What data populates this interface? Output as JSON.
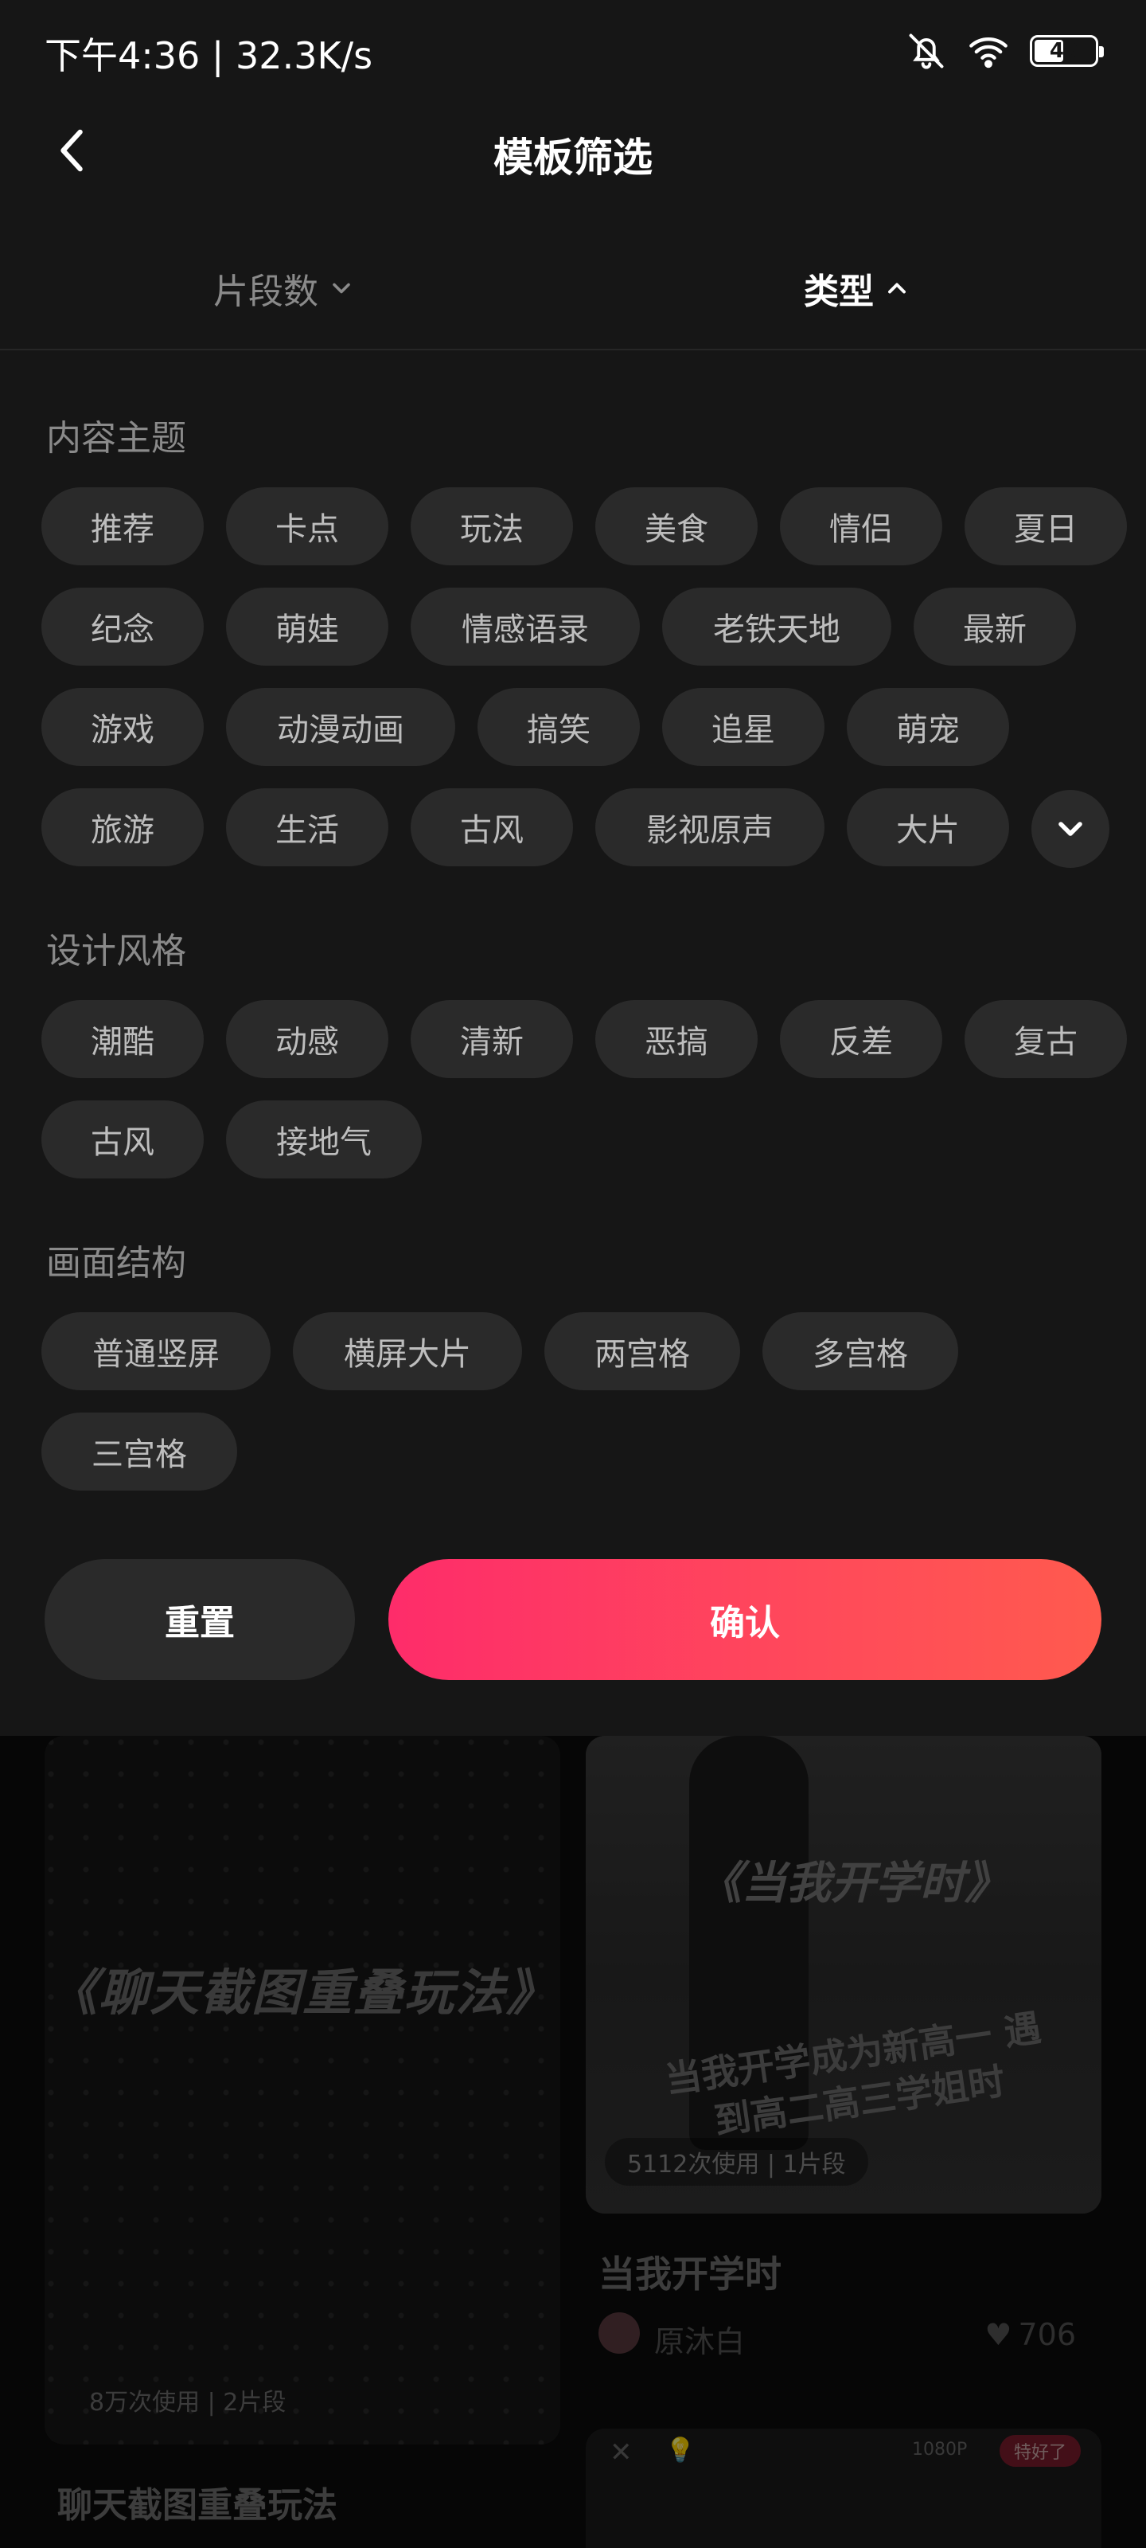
{
  "status_bar": {
    "time": "下午4:36 | 32.3K/s",
    "battery": "49",
    "battery_level": 0.49,
    "icons": [
      "mute-bell-icon",
      "wifi-icon",
      "battery-icon"
    ]
  },
  "nav": {
    "title": "模板筛选",
    "back_icon": "chevron-left-icon"
  },
  "tabs": [
    {
      "label": "片段数",
      "state": "collapsed"
    },
    {
      "label": "类型",
      "state": "expanded"
    }
  ],
  "sections": {
    "content_theme": {
      "title": "内容主题",
      "chips": [
        "推荐",
        "卡点",
        "玩法",
        "美食",
        "情侣",
        "夏日",
        "纪念",
        "萌娃",
        "情感语录",
        "老铁天地",
        "最新",
        "游戏",
        "动漫动画",
        "搞笑",
        "追星",
        "萌宠",
        "旅游",
        "生活",
        "古风",
        "影视原声",
        "大片"
      ]
    },
    "design_style": {
      "title": "设计风格",
      "chips": [
        "潮酷",
        "动感",
        "清新",
        "恶搞",
        "反差",
        "复古",
        "古风",
        "接地气"
      ]
    },
    "layout": {
      "title": "画面结构",
      "chips": [
        "普通竖屏",
        "横屏大片",
        "两宫格",
        "多宫格",
        "三宫格"
      ]
    }
  },
  "actions": {
    "reset": "重置",
    "confirm": "确认"
  },
  "background": {
    "card_left": {
      "tagline": "《聊天截图重叠玩法》",
      "usage": "8万次使用 | 2片段",
      "title": "聊天截图重叠玩法"
    },
    "card_right": {
      "quote": "《当我开学时》",
      "subtitle": "当我开学成为新高一 遇到高二高三学姐时",
      "usage": "5112次使用 | 1片段",
      "title": "当我开学时",
      "author": "原沐白",
      "likes": "706"
    },
    "card_right2": {
      "resolution": "1080P",
      "badge": "特好了"
    }
  },
  "colors": {
    "panel_bg": "#161616",
    "chip_bg": "#2a2a2a",
    "accent_start": "#fe2c6a",
    "accent_end": "#ff5a4e"
  }
}
